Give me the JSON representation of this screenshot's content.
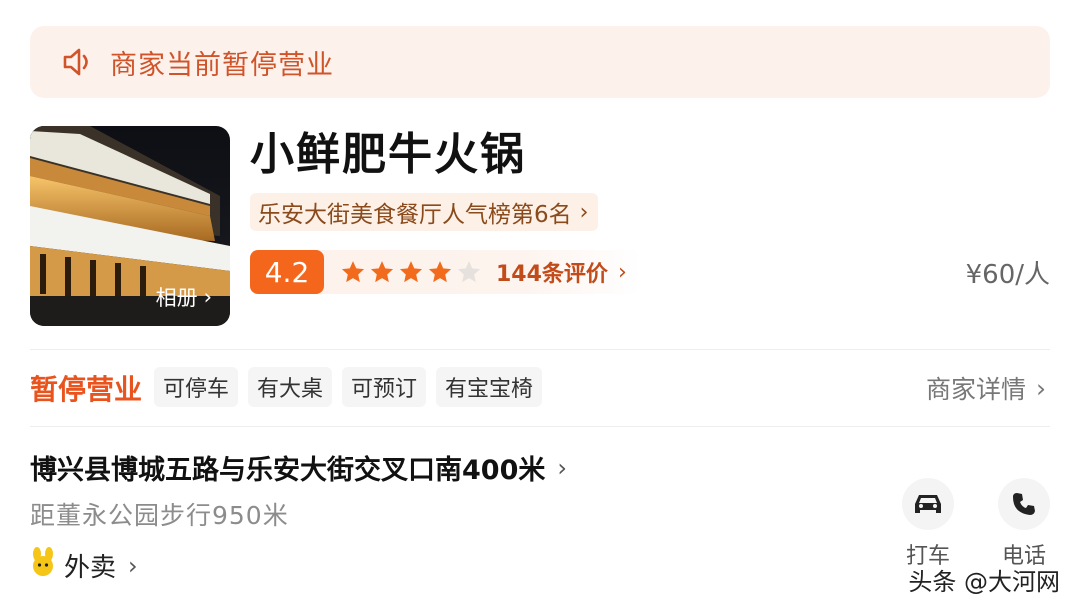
{
  "notice": {
    "icon": "speaker-icon",
    "text": "商家当前暂停营业"
  },
  "shop": {
    "name": "小鲜肥牛火锅",
    "photo_alt": "restaurant-storefront-photo",
    "album_label": "相册",
    "rank_label": "乐安大街美食餐厅人气榜第6名",
    "rating": "4.2",
    "stars_filled": 4,
    "stars_total": 5,
    "reviews_label": "144条评价",
    "price": "¥60/人"
  },
  "info_row": {
    "status": "暂停营业",
    "tags": [
      "可停车",
      "有大桌",
      "可预订",
      "有宝宝椅"
    ],
    "merchant_detail_label": "商家详情"
  },
  "location": {
    "address": "博兴县博城五路与乐安大街交叉口南400米",
    "distance": "距董永公园步行950米",
    "delivery_label": "外卖"
  },
  "actions": [
    {
      "icon": "car-icon",
      "label": "打车"
    },
    {
      "icon": "phone-icon",
      "label": "电话"
    }
  ],
  "watermark": "头条 @大河网",
  "colors": {
    "accent": "#f4661c",
    "status": "#e9541e",
    "notice_bg": "#fdf1ec",
    "notice_text": "#d0542a"
  }
}
